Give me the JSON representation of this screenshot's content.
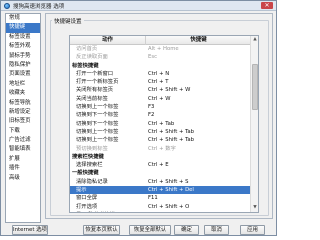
{
  "window": {
    "title": "搜狗高速浏览器 选项",
    "close_glyph": "✕"
  },
  "sidebar": {
    "items": [
      {
        "label": "常规"
      },
      {
        "label": "快捷键"
      },
      {
        "label": "标签设置"
      },
      {
        "label": "标签外观"
      },
      {
        "label": "鼠标手势"
      },
      {
        "label": "隐私保护"
      },
      {
        "label": "页面设置"
      },
      {
        "label": "地址栏"
      },
      {
        "label": "收藏夹"
      },
      {
        "label": "标签导航"
      },
      {
        "label": "新增设定"
      },
      {
        "label": "旧标签页"
      },
      {
        "label": "下载"
      },
      {
        "label": "广告过滤"
      },
      {
        "label": "智能填表"
      },
      {
        "label": "扩展"
      },
      {
        "label": "插件"
      },
      {
        "label": "高级"
      }
    ],
    "selected_index": 1
  },
  "shortcuts": {
    "group_title": "快捷键设置",
    "columns": [
      "动作",
      "快捷键"
    ],
    "rows": [
      {
        "action": "访问首页",
        "key": "Alt + Home",
        "type": "disabled"
      },
      {
        "action": "反正读取页面",
        "key": "Esc",
        "type": "disabled"
      },
      {
        "action": "标签快捷键",
        "key": "",
        "type": "section"
      },
      {
        "action": "打开一个新窗口",
        "key": "Ctrl + N",
        "type": "normal"
      },
      {
        "action": "打开一个新标签页",
        "key": "Ctrl + T",
        "type": "normal"
      },
      {
        "action": "关闭所有标签页",
        "key": "Ctrl + Shift + W",
        "type": "normal"
      },
      {
        "action": "关闭当前标签",
        "key": "Ctrl + W",
        "type": "normal"
      },
      {
        "action": "切换到上一个标签",
        "key": "F3",
        "type": "normal"
      },
      {
        "action": "切换到下一个标签",
        "key": "F2",
        "type": "normal"
      },
      {
        "action": "切换到下一个标签",
        "key": "Ctrl + Tab",
        "type": "normal"
      },
      {
        "action": "切换到上一个标签",
        "key": "Ctrl + Shift + Tab",
        "type": "normal"
      },
      {
        "action": "切换到上一个标签",
        "key": "Ctrl + Shift + Tab",
        "type": "normal"
      },
      {
        "action": "预切换到标签",
        "key": "Ctrl + 数字",
        "type": "disabled"
      },
      {
        "action": "搜索栏快捷键",
        "key": "",
        "type": "section"
      },
      {
        "action": "选择搜索栏",
        "key": "Ctrl + E",
        "type": "normal"
      },
      {
        "action": "一般快捷键",
        "key": "",
        "type": "section"
      },
      {
        "action": "清除隐私记录",
        "key": "Ctrl + Shift + S",
        "type": "normal"
      },
      {
        "action": "提示",
        "key": "Ctrl + Shift + Del",
        "type": "selected"
      },
      {
        "action": "窗口全屏",
        "key": "F11",
        "type": "normal"
      },
      {
        "action": "打开选项",
        "key": "Ctrl + Shift + O",
        "type": "normal"
      },
      {
        "action": "显示/隐藏书签栏",
        "key": "Ctrl + B",
        "type": "normal"
      }
    ]
  },
  "scrollbar": {
    "up_glyph": "▲",
    "down_glyph": "▼"
  },
  "buttons": {
    "internet_options": "Internet 选项",
    "reset_all": "恢复本页默认",
    "reset_page": "恢复全部默认",
    "ok": "确定",
    "cancel": "取消",
    "apply": "应用"
  }
}
